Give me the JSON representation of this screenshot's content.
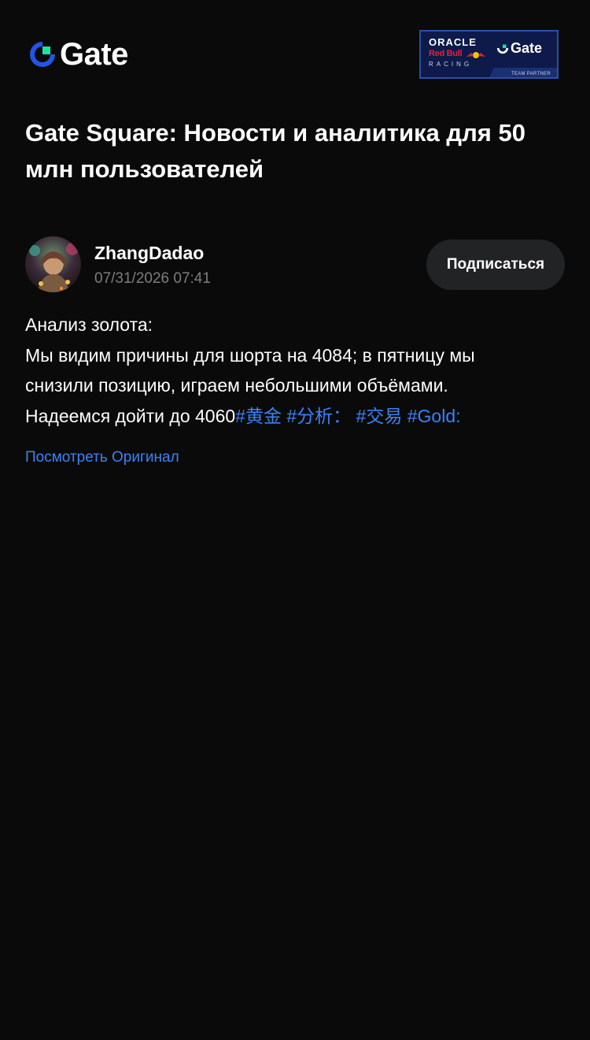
{
  "header": {
    "logo_text": "Gate",
    "logo_icon": "gate-logo-icon",
    "partner_badge": {
      "oracle": "ORACLE",
      "redbull": "Red Bull",
      "racing": "RACING",
      "gate": "Gate",
      "subtitle": "TEAM PARTNER"
    }
  },
  "page": {
    "title": "Gate Square: Новости и аналитика для 50 млн пользователей"
  },
  "post": {
    "author": {
      "name": "ZhangDadao",
      "avatar_icon": "avatar-image"
    },
    "timestamp": "07/31/2026 07:41",
    "follow_label": "Подписаться",
    "lines": [
      "Анализ золота:",
      "Мы видим причины для шорта на 4084; в пятницу мы",
      "снизили позицию, играем небольшими объёмами.",
      "Надеемся дойти до 4060"
    ],
    "hashtags": [
      "#黄金",
      "#分析：",
      "#交易",
      "#Gold:"
    ],
    "view_original_label": "Посмотреть Оригинал"
  },
  "colors": {
    "background": "#0a0a0a",
    "text": "#ffffff",
    "muted": "#7d7d7d",
    "link": "#3b82f6",
    "button_bg": "#222324",
    "brand_blue": "#2354e6",
    "brand_green": "#17e6a1"
  }
}
